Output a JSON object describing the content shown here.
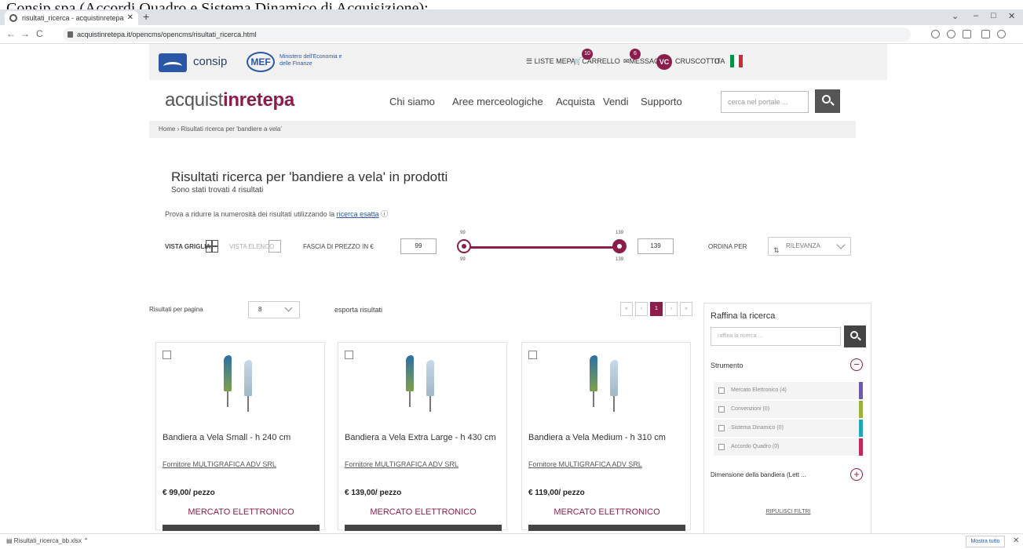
{
  "caption": "Consip spa (Accordi Quadro e Sistema Dinamico di Acquisizione);",
  "browser": {
    "tab_title": "risultati_ricerca - acquistinretepa",
    "url": "acquistinretepa.it/opencms/opencms/risultati_ricerca.html",
    "window_controls": [
      "⌄",
      "–",
      "□",
      "✕"
    ]
  },
  "topbar": {
    "consip": "consip",
    "mef": "MEF",
    "mef_sub": "Ministero dell'Economia e delle Finanze",
    "liste_mepa": "LISTE MEPA",
    "carrello": "CARRELLO",
    "carrello_count": "10",
    "messaggi": "MESSAGGI",
    "messaggi_count": "6",
    "vc": "VC",
    "cruscotto": "CRUSCOTTO",
    "lang": "ITA",
    "flag_colors": [
      "#009246",
      "#ffffff",
      "#ce2b37"
    ]
  },
  "nav": {
    "brand_a": "acquist",
    "brand_b": "inrete",
    "brand_c": "pa",
    "links": [
      "Chi siamo",
      "Aree merceologiche",
      "Acquista",
      "Vendi",
      "Supporto"
    ],
    "search_placeholder": "cerca nel portale ..."
  },
  "breadcrumb": "Home  ›  Risultati ricerca per 'bandiere a vela'",
  "results": {
    "title": "Risultati ricerca per 'bandiere a vela' in prodotti",
    "subtitle": "Sono stati trovati 4 risultati",
    "hint": "Prova a ridurre la numerosità dei risultati utilizzando la ",
    "hint_link": "ricerca esatta"
  },
  "controls": {
    "vista_griglia": "VISTA GRIGLIA",
    "vista_elenco": "VISTA ELENCO",
    "fascia_prezzo": "FASCIA DI PREZZO IN €",
    "price_min": "99",
    "price_max": "139",
    "tick_min_top": "99",
    "tick_max_top": "139",
    "tick_min_bottom": "99",
    "tick_max_bottom": "139",
    "ordina_per": "ORDINA PER",
    "sort_value": "RILEVANZA"
  },
  "toolbar": {
    "per_page_label": "Risultati per pagina",
    "per_page_value": "8",
    "export": "esporta risultati",
    "pager": [
      "«",
      "‹",
      "1",
      "›",
      "»"
    ]
  },
  "products": [
    {
      "title": "Bandiera a Vela Small - h 240 cm",
      "supplier": "Fornitore MULTIGRAFICA ADV SRL",
      "price": "€ 99,00/ pezzo",
      "market": "MERCATO ELETTRONICO"
    },
    {
      "title": "Bandiera a Vela Extra Large - h 430 cm",
      "supplier": "Fornitore MULTIGRAFICA ADV SRL",
      "price": "€ 139,00/ pezzo",
      "market": "MERCATO ELETTRONICO"
    },
    {
      "title": "Bandiera a Vela Medium - h 310 cm",
      "supplier": "Fornitore MULTIGRAFICA ADV SRL",
      "price": "€ 119,00/ pezzo",
      "market": "MERCATO ELETTRONICO"
    }
  ],
  "sidebar": {
    "title": "Raffina la ricerca",
    "search_placeholder": "raffina la ricerca ...",
    "strumento": "Strumento",
    "items": [
      {
        "label": "Mercato Elettronico (4)",
        "color": "#6a5aa8"
      },
      {
        "label": "Convenzioni (0)",
        "color": "#9bb23a"
      },
      {
        "label": "Sistema Dinamico (0)",
        "color": "#1fa6b8"
      },
      {
        "label": "Accordo Quadro (0)",
        "color": "#c2285a"
      }
    ],
    "dimensione": "Dimensione della bandiera (Lett ...",
    "reset": "RIPULISCI FILTRI"
  },
  "statusbar": {
    "download": "Risultati_ricerca_bb.xlsx",
    "show_all": "Mostra tutto"
  },
  "colors": {
    "accent": "#8a1d4c"
  }
}
